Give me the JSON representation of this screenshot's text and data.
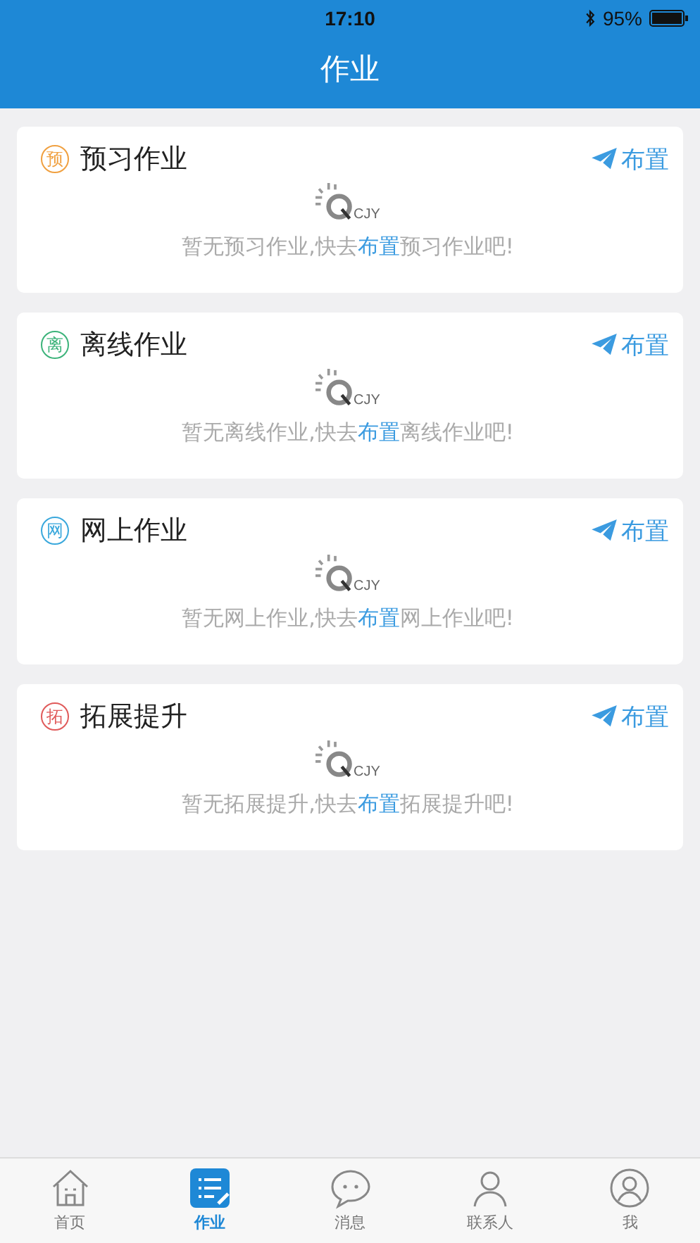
{
  "status_bar": {
    "time": "17:10",
    "battery": "95%"
  },
  "header": {
    "title": "作业"
  },
  "cards": [
    {
      "badge": "预",
      "color": "#f0a040",
      "title": "预习作业",
      "action": "布置",
      "logo": "CJY",
      "message": {
        "before": "暂无预习作业,快去",
        "link": "布置",
        "after": "预习作业吧!"
      }
    },
    {
      "badge": "离",
      "color": "#3cb37a",
      "title": "离线作业",
      "action": "布置",
      "logo": "CJY",
      "message": {
        "before": "暂无离线作业,快去",
        "link": "布置",
        "after": "离线作业吧!"
      }
    },
    {
      "badge": "网",
      "color": "#3aa8dc",
      "title": "网上作业",
      "action": "布置",
      "logo": "CJY",
      "message": {
        "before": "暂无网上作业,快去",
        "link": "布置",
        "after": "网上作业吧!"
      }
    },
    {
      "badge": "拓",
      "color": "#e05a5a",
      "title": "拓展提升",
      "action": "布置",
      "logo": "CJY",
      "message": {
        "before": "暂无拓展提升,快去",
        "link": "布置",
        "after": "拓展提升吧!"
      }
    }
  ],
  "tab_bar": [
    {
      "kind": "home",
      "label": "首页",
      "selected": false
    },
    {
      "kind": "homework",
      "label": "作业",
      "selected": true
    },
    {
      "kind": "messages",
      "label": "消息",
      "selected": false
    },
    {
      "kind": "contacts",
      "label": "联系人",
      "selected": false
    },
    {
      "kind": "me",
      "label": "我",
      "selected": false
    }
  ]
}
